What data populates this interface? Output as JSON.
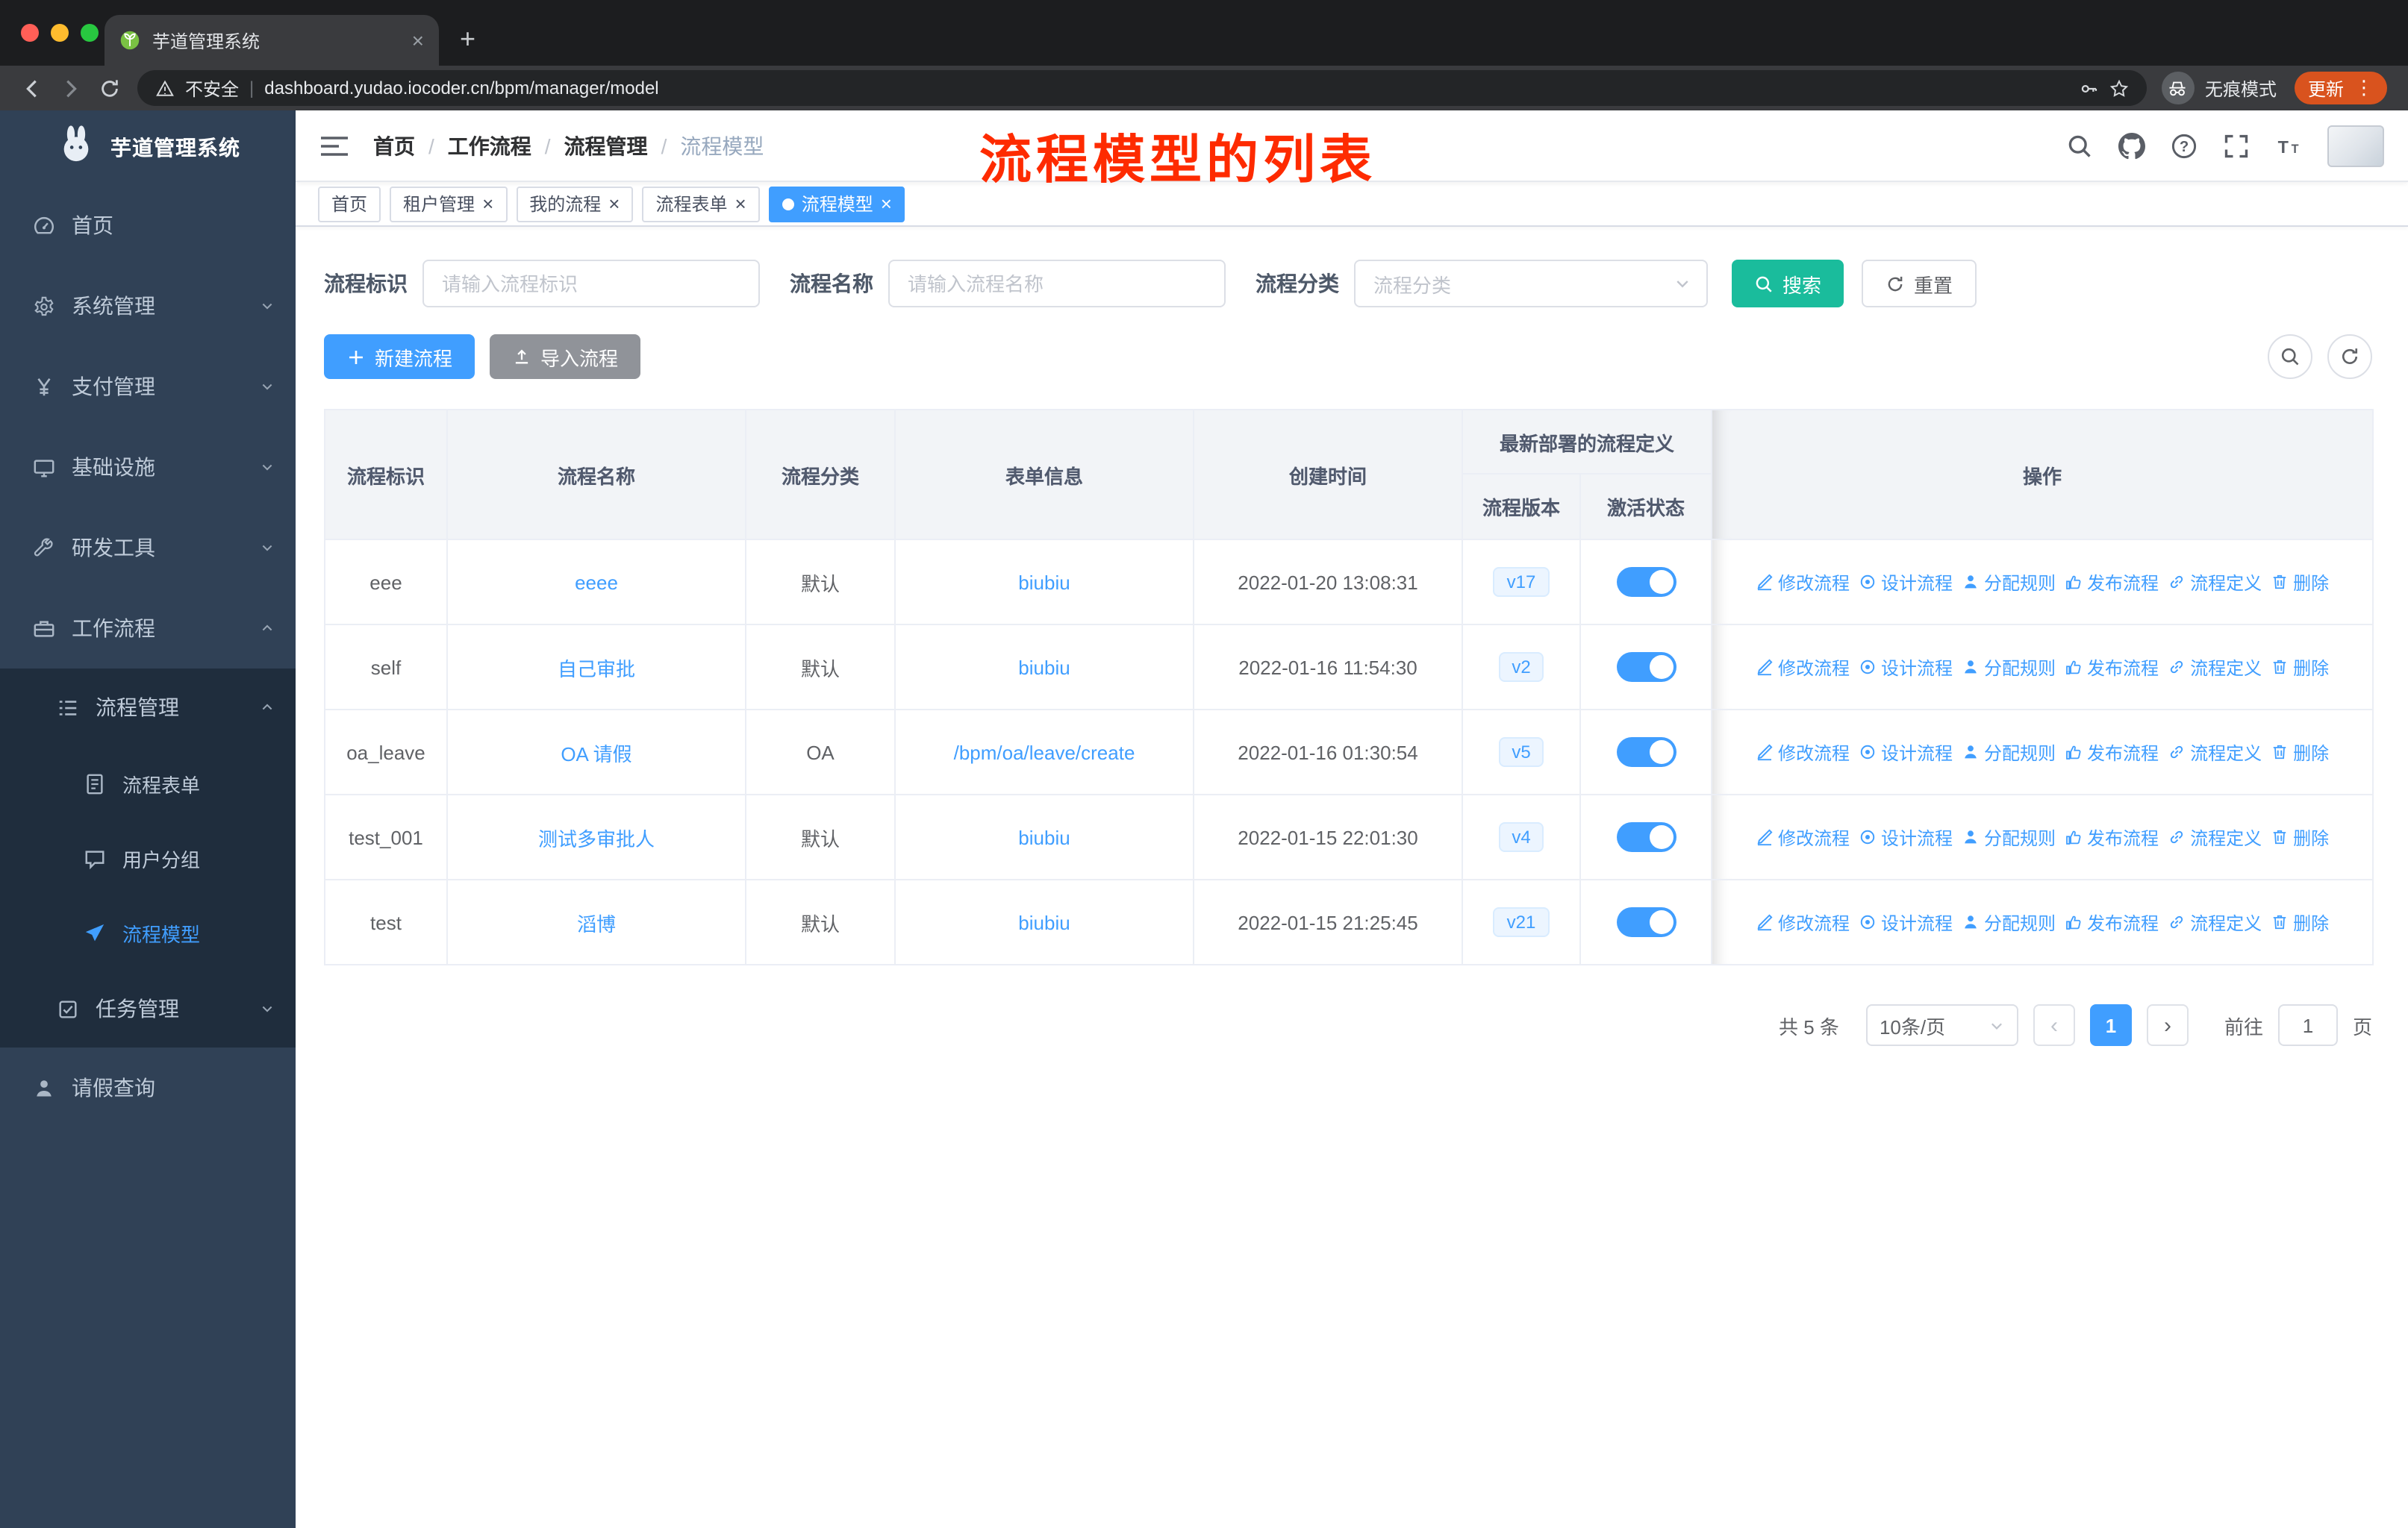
{
  "browser": {
    "tab_title": "芋道管理系统",
    "security_label": "不安全",
    "url": "dashboard.yudao.iocoder.cn/bpm/manager/model",
    "incognito_label": "无痕模式",
    "update_label": "更新"
  },
  "glyphs": {
    "close": "×",
    "plus": "+",
    "dots": "⋮",
    "prev": "‹",
    "next": "›",
    "divider": "|"
  },
  "sidebar": {
    "app_title": "芋道管理系统",
    "items": [
      {
        "label": "首页",
        "icon": "dashboard",
        "level": 1
      },
      {
        "label": "系统管理",
        "icon": "gear",
        "level": 1,
        "arrow": "down"
      },
      {
        "label": "支付管理",
        "icon": "yen",
        "level": 1,
        "arrow": "down"
      },
      {
        "label": "基础设施",
        "icon": "infra",
        "level": 1,
        "arrow": "down"
      },
      {
        "label": "研发工具",
        "icon": "tools",
        "level": 1,
        "arrow": "down"
      },
      {
        "label": "工作流程",
        "icon": "workflow",
        "level": 1,
        "arrow": "up"
      },
      {
        "label": "流程管理",
        "icon": "list",
        "level": 2,
        "arrow": "up",
        "dark": true
      },
      {
        "label": "流程表单",
        "icon": "form",
        "level": 3,
        "dark": true
      },
      {
        "label": "用户分组",
        "icon": "chat",
        "level": 3,
        "dark": true
      },
      {
        "label": "流程模型",
        "icon": "send",
        "level": 3,
        "dark": true,
        "active": true
      },
      {
        "label": "任务管理",
        "icon": "task",
        "level": 2,
        "arrow": "down",
        "dark": true
      },
      {
        "label": "请假查询",
        "icon": "user",
        "level": 1
      }
    ]
  },
  "navbar": {
    "breadcrumb": [
      "首页",
      "工作流程",
      "流程管理",
      "流程模型"
    ],
    "separator": "/",
    "annotation": "流程模型的列表"
  },
  "tags": [
    {
      "label": "首页",
      "closable": false,
      "active": false
    },
    {
      "label": "租户管理",
      "closable": true,
      "active": false
    },
    {
      "label": "我的流程",
      "closable": true,
      "active": false
    },
    {
      "label": "流程表单",
      "closable": true,
      "active": false
    },
    {
      "label": "流程模型",
      "closable": true,
      "active": true
    }
  ],
  "filters": {
    "fields": [
      {
        "label": "流程标识",
        "placeholder": "请输入流程标识",
        "type": "input"
      },
      {
        "label": "流程名称",
        "placeholder": "请输入流程名称",
        "type": "input"
      },
      {
        "label": "流程分类",
        "placeholder": "流程分类",
        "type": "select"
      }
    ],
    "search_label": "搜索",
    "reset_label": "重置"
  },
  "toolbar": {
    "create_label": "新建流程",
    "import_label": "导入流程"
  },
  "table": {
    "columns": [
      "流程标识",
      "流程名称",
      "流程分类",
      "表单信息",
      "创建时间",
      "流程版本",
      "激活状态",
      "操作"
    ],
    "group_header": "最新部署的流程定义",
    "actions": [
      "修改流程",
      "设计流程",
      "分配规则",
      "发布流程",
      "流程定义",
      "删除"
    ],
    "rows": [
      {
        "key": "eee",
        "name": "eeee",
        "category": "默认",
        "form": "biubiu",
        "created": "2022-01-20 13:08:31",
        "version": "v17",
        "active": true
      },
      {
        "key": "self",
        "name": "自己审批",
        "category": "默认",
        "form": "biubiu",
        "created": "2022-01-16 11:54:30",
        "version": "v2",
        "active": true
      },
      {
        "key": "oa_leave",
        "name": "OA 请假",
        "category": "OA",
        "form": "/bpm/oa/leave/create",
        "created": "2022-01-16 01:30:54",
        "version": "v5",
        "active": true
      },
      {
        "key": "test_001",
        "name": "测试多审批人",
        "category": "默认",
        "form": "biubiu",
        "created": "2022-01-15 22:01:30",
        "version": "v4",
        "active": true
      },
      {
        "key": "test",
        "name": "滔博",
        "category": "默认",
        "form": "biubiu",
        "created": "2022-01-15 21:25:45",
        "version": "v21",
        "active": true
      }
    ]
  },
  "pagination": {
    "total_label": "共 5 条",
    "page_size": "10条/页",
    "current_page": "1",
    "goto_label": "前往",
    "goto_value": "1",
    "page_suffix": "页"
  },
  "colors": {
    "primary": "#409eff",
    "search_button": "#1abc9c",
    "import_button": "#909399",
    "sidebar_bg": "#304156",
    "submenu_bg": "#1f2d3d",
    "annotation_red": "#fe2b00",
    "update_chip": "#d9531e",
    "traffic_lights": [
      "#ff5f57",
      "#febc2e",
      "#28c840"
    ]
  }
}
